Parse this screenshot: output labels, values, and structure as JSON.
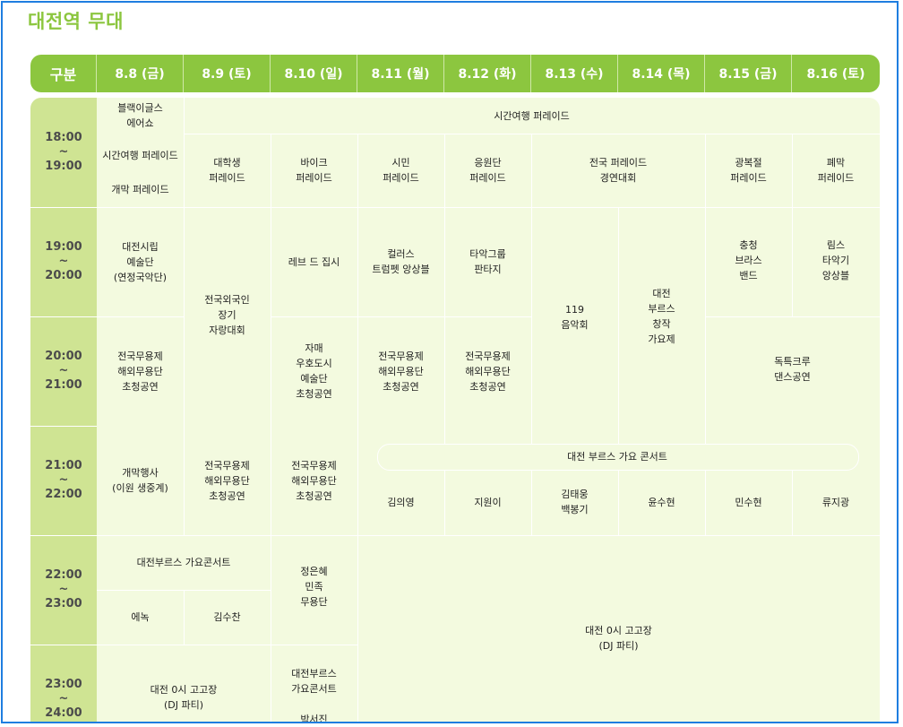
{
  "page_title": "대전역 무대",
  "header": {
    "label": "구분",
    "dates": [
      "8.8 (금)",
      "8.9 (토)",
      "8.10 (일)",
      "8.11 (월)",
      "8.12 (화)",
      "8.13 (수)",
      "8.14 (목)",
      "8.15 (금)",
      "8.16 (토)"
    ]
  },
  "times": [
    {
      "start": "18:00",
      "sep": "~",
      "end": "19:00"
    },
    {
      "start": "19:00",
      "sep": "~",
      "end": "20:00"
    },
    {
      "start": "20:00",
      "sep": "~",
      "end": "21:00"
    },
    {
      "start": "21:00",
      "sep": "~",
      "end": "22:00"
    },
    {
      "start": "22:00",
      "sep": "~",
      "end": "23:00"
    },
    {
      "start": "23:00",
      "sep": "~",
      "end": "24:00"
    }
  ],
  "events": {
    "blackeagles": [
      "블랙이글스",
      "에어쇼"
    ],
    "time_travel_top": "시간여행 퍼레이드",
    "d1_parade": "시간여행 퍼레이드",
    "d1_opening_parade": "개막 퍼레이드",
    "college_parade": [
      "대학생",
      "퍼레이드"
    ],
    "bike_parade": [
      "바이크",
      "퍼레이드"
    ],
    "citizen_parade": [
      "시민",
      "퍼레이드"
    ],
    "cheer_parade": [
      "응원단",
      "퍼레이드"
    ],
    "national_parade": [
      "전국 퍼레이드",
      "경연대회"
    ],
    "liberation_parade": [
      "광복절",
      "퍼레이드"
    ],
    "closing_parade": [
      "폐막",
      "퍼레이드"
    ],
    "city_art_troupe": [
      "대전시립",
      "예술단",
      "(연정국악단)"
    ],
    "national_janggi": [
      "전국외국인",
      "장기",
      "자랑대회"
    ],
    "lev_jipsi": "레브 드 집시",
    "colors_trumpet": "컬러스",
    "colors_trumpet_2": "트럼펫 앙상블",
    "taak_group": [
      "타악그룹",
      "판타지"
    ],
    "band_119": [
      "119",
      "음악회"
    ],
    "daejeon_blues_song": [
      "대전",
      "부르스",
      "창작",
      "가요제"
    ],
    "chungcheong_brass": [
      "충청",
      "브라스",
      "밴드"
    ],
    "rims_taak": [
      "림스",
      "타악기",
      "앙상블"
    ],
    "dance_day1": [
      "전국무용제",
      "해외무용단",
      "초청공연"
    ],
    "jamae_dance": [
      "자매",
      "우호도시",
      "예술단",
      "초청공연"
    ],
    "dance_d4": [
      "전국무용제",
      "해외무용단",
      "초청공연"
    ],
    "dance_d5": [
      "전국무용제",
      "해외무용단",
      "초청공연"
    ],
    "dokdok_crew": [
      "독특크루",
      "댄스공연"
    ],
    "opening_ceremony": [
      "개막행사",
      "(이원 생중계)"
    ],
    "dance_d2": [
      "전국무용제",
      "해외무용단",
      "초청공연"
    ],
    "dance_d3": [
      "전국무용제",
      "해외무용단",
      "초청공연"
    ],
    "blues_concert_title": "대전 부르스 가요 콘서트",
    "singers": [
      "김의영",
      "지원이"
    ],
    "singer_kim_baek": [
      "김태웅",
      "백봉기"
    ],
    "singers_b": [
      "윤수현",
      "민수현",
      "류지광"
    ],
    "blues_concert_22": "대전부르스 가요콘서트",
    "enok": "에녹",
    "kim_suchan": "김수찬",
    "jeong_eunhye": [
      "정은혜",
      "민족",
      "무용단"
    ],
    "dj_party_big": [
      "대전 0시 고고장",
      "(DJ 파티)"
    ],
    "dj_party_small": [
      "대전 0시 고고장",
      "(DJ 파티)"
    ],
    "blues_concert_23": [
      "대전부르스",
      "가요콘서트",
      "",
      "박서진"
    ]
  }
}
